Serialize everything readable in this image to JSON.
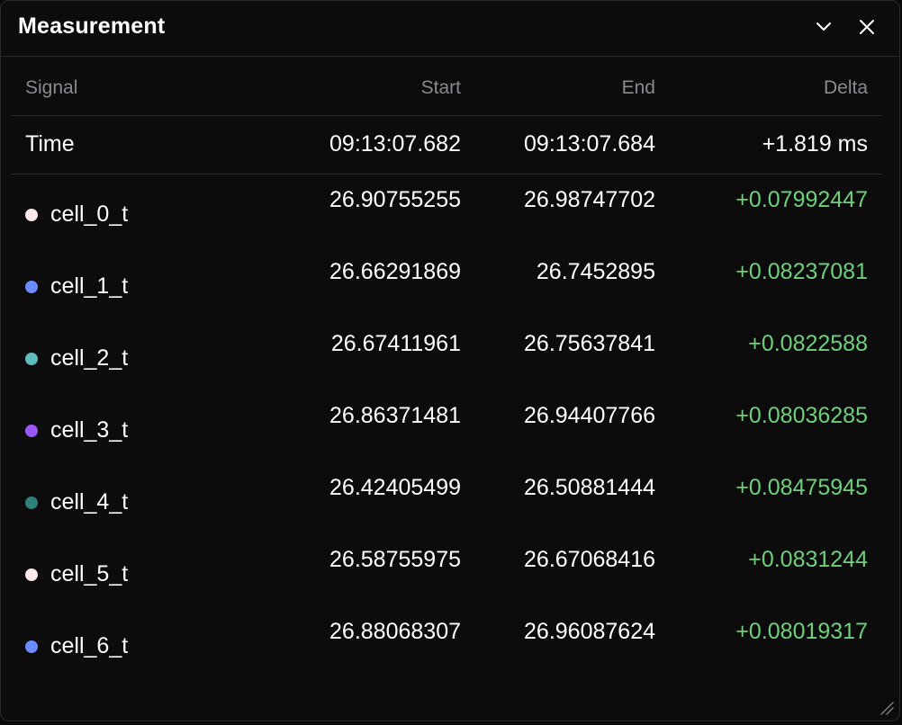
{
  "panel": {
    "title": "Measurement",
    "collapse_icon": "chevron-down-icon",
    "close_icon": "close-icon"
  },
  "table": {
    "headers": {
      "signal": "Signal",
      "start": "Start",
      "end": "End",
      "delta": "Delta"
    },
    "time_row": {
      "label": "Time",
      "start": "09:13:07.682",
      "end": "09:13:07.684",
      "delta": "+1.819 ms"
    },
    "rows": [
      {
        "signal": "cell_0_t",
        "color": "#fbe9ea",
        "start": "26.90755255",
        "end": "26.98747702",
        "delta": "+0.07992447"
      },
      {
        "signal": "cell_1_t",
        "color": "#6b8cff",
        "start": "26.66291869",
        "end": "26.7452895",
        "delta": "+0.08237081"
      },
      {
        "signal": "cell_2_t",
        "color": "#5dbdbd",
        "start": "26.67411961",
        "end": "26.75637841",
        "delta": "+0.0822588"
      },
      {
        "signal": "cell_3_t",
        "color": "#9a55f5",
        "start": "26.86371481",
        "end": "26.94407766",
        "delta": "+0.08036285"
      },
      {
        "signal": "cell_4_t",
        "color": "#2f7f7a",
        "start": "26.42405499",
        "end": "26.50881444",
        "delta": "+0.08475945"
      },
      {
        "signal": "cell_5_t",
        "color": "#fbe9ea",
        "start": "26.58755975",
        "end": "26.67068416",
        "delta": "+0.0831244"
      },
      {
        "signal": "cell_6_t",
        "color": "#6b8cff",
        "start": "26.88068307",
        "end": "26.96087624",
        "delta": "+0.08019317"
      }
    ]
  },
  "colors": {
    "background": "#0c0c0d",
    "text": "#ffffff",
    "muted": "#8a8a8e",
    "delta_positive": "#6fcf7c",
    "divider": "#2a2a2c"
  }
}
